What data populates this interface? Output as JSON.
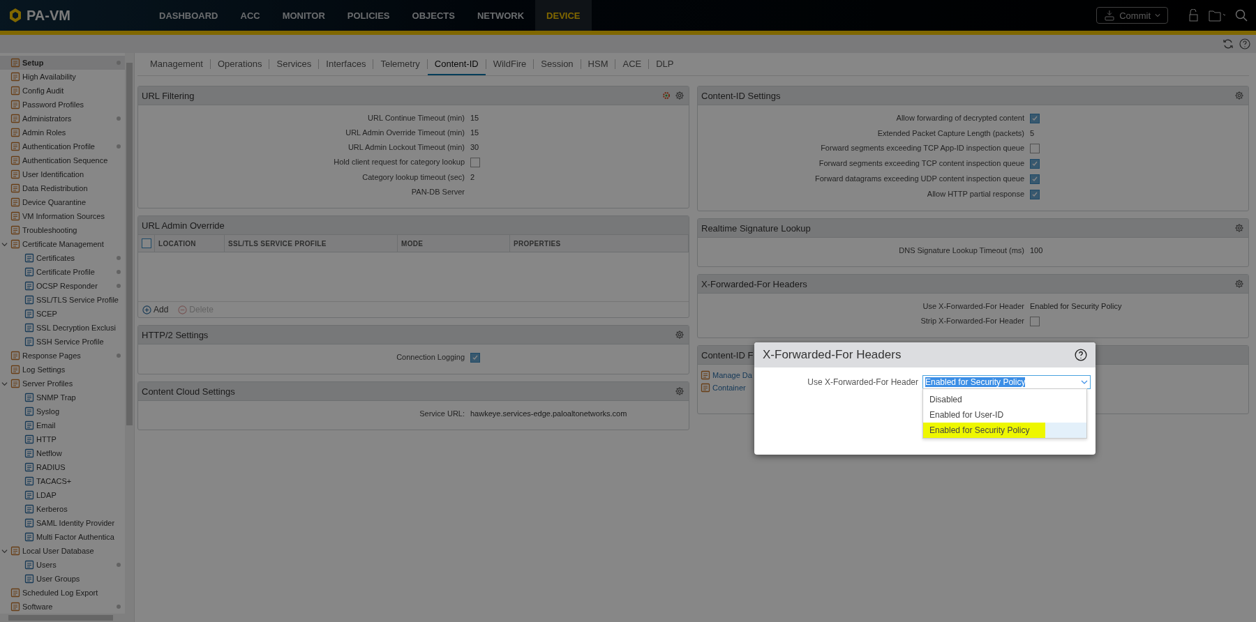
{
  "app": {
    "name": "PA-VM"
  },
  "nav": [
    {
      "label": "DASHBOARD",
      "selected": false
    },
    {
      "label": "ACC",
      "selected": false
    },
    {
      "label": "MONITOR",
      "selected": false
    },
    {
      "label": "POLICIES",
      "selected": false
    },
    {
      "label": "OBJECTS",
      "selected": false
    },
    {
      "label": "NETWORK",
      "selected": false
    },
    {
      "label": "DEVICE",
      "selected": true
    }
  ],
  "commit": {
    "label": "Commit"
  },
  "sidebar": {
    "items": [
      {
        "label": "Setup",
        "selected": true,
        "dot": true
      },
      {
        "label": "High Availability",
        "selected": false,
        "dot": false
      },
      {
        "label": "Config Audit",
        "selected": false,
        "dot": false
      },
      {
        "label": "Password Profiles",
        "selected": false,
        "dot": false
      },
      {
        "label": "Administrators",
        "selected": false,
        "dot": true
      },
      {
        "label": "Admin Roles",
        "selected": false,
        "dot": false
      },
      {
        "label": "Authentication Profile",
        "selected": false,
        "dot": true
      },
      {
        "label": "Authentication Sequence",
        "selected": false,
        "dot": false
      },
      {
        "label": "User Identification",
        "selected": false,
        "dot": false
      },
      {
        "label": "Data Redistribution",
        "selected": false,
        "dot": false
      },
      {
        "label": "Device Quarantine",
        "selected": false,
        "dot": false
      },
      {
        "label": "VM Information Sources",
        "selected": false,
        "dot": false
      },
      {
        "label": "Troubleshooting",
        "selected": false,
        "dot": false
      },
      {
        "label": "Certificate Management",
        "selected": false,
        "dot": false,
        "expanded": true,
        "children": [
          {
            "label": "Certificates",
            "selected": false,
            "dot": true
          },
          {
            "label": "Certificate Profile",
            "selected": false,
            "dot": true
          },
          {
            "label": "OCSP Responder",
            "selected": false,
            "dot": true
          },
          {
            "label": "SSL/TLS Service Profile",
            "selected": false,
            "dot": false
          },
          {
            "label": "SCEP",
            "selected": false,
            "dot": false
          },
          {
            "label": "SSL Decryption Exclusi",
            "selected": false,
            "dot": false
          },
          {
            "label": "SSH Service Profile",
            "selected": false,
            "dot": false
          }
        ]
      },
      {
        "label": "Response Pages",
        "selected": false,
        "dot": true
      },
      {
        "label": "Log Settings",
        "selected": false,
        "dot": false
      },
      {
        "label": "Server Profiles",
        "selected": false,
        "dot": false,
        "expanded": true,
        "children": [
          {
            "label": "SNMP Trap",
            "selected": false,
            "dot": false
          },
          {
            "label": "Syslog",
            "selected": false,
            "dot": false
          },
          {
            "label": "Email",
            "selected": false,
            "dot": false
          },
          {
            "label": "HTTP",
            "selected": false,
            "dot": false
          },
          {
            "label": "Netflow",
            "selected": false,
            "dot": false
          },
          {
            "label": "RADIUS",
            "selected": false,
            "dot": false
          },
          {
            "label": "TACACS+",
            "selected": false,
            "dot": false
          },
          {
            "label": "LDAP",
            "selected": false,
            "dot": false
          },
          {
            "label": "Kerberos",
            "selected": false,
            "dot": false
          },
          {
            "label": "SAML Identity Provider",
            "selected": false,
            "dot": false
          },
          {
            "label": "Multi Factor Authentica",
            "selected": false,
            "dot": false
          }
        ]
      },
      {
        "label": "Local User Database",
        "selected": false,
        "dot": false,
        "expanded": true,
        "children": [
          {
            "label": "Users",
            "selected": false,
            "dot": true
          },
          {
            "label": "User Groups",
            "selected": false,
            "dot": false
          }
        ]
      },
      {
        "label": "Scheduled Log Export",
        "selected": false,
        "dot": false
      },
      {
        "label": "Software",
        "selected": false,
        "dot": true
      }
    ]
  },
  "tabs": [
    {
      "label": "Management",
      "selected": false
    },
    {
      "label": "Operations",
      "selected": false
    },
    {
      "label": "Services",
      "selected": false
    },
    {
      "label": "Interfaces",
      "selected": false
    },
    {
      "label": "Telemetry",
      "selected": false
    },
    {
      "label": "Content-ID",
      "selected": true
    },
    {
      "label": "WildFire",
      "selected": false
    },
    {
      "label": "Session",
      "selected": false
    },
    {
      "label": "HSM",
      "selected": false
    },
    {
      "label": "ACE",
      "selected": false
    },
    {
      "label": "DLP",
      "selected": false
    }
  ],
  "left_panels": [
    {
      "kind": "form",
      "title": "URL Filtering",
      "editable": true,
      "status_icon": true,
      "rows": [
        {
          "kind": "value",
          "label": "URL Continue Timeout (min)",
          "value": "15"
        },
        {
          "kind": "value",
          "label": "URL Admin Override Timeout (min)",
          "value": "15"
        },
        {
          "kind": "value",
          "label": "URL Admin Lockout Timeout (min)",
          "value": "30"
        },
        {
          "kind": "checkbox",
          "label": "Hold client request for category lookup",
          "checked": false
        },
        {
          "kind": "value",
          "label": "Category lookup timeout (sec)",
          "value": "2"
        },
        {
          "kind": "label",
          "label": "PAN-DB Server"
        }
      ]
    },
    {
      "kind": "table",
      "title": "URL Admin Override",
      "editable": false,
      "status_icon": false,
      "header_checked": false,
      "columns": [
        "LOCATION",
        "SSL/TLS SERVICE PROFILE",
        "MODE",
        "PROPERTIES"
      ],
      "actions": [
        {
          "label": "Add",
          "disabled": false
        },
        {
          "label": "Delete",
          "disabled": true
        }
      ]
    },
    {
      "kind": "form",
      "title": "HTTP/2 Settings",
      "editable": true,
      "status_icon": false,
      "rows": [
        {
          "kind": "checkbox",
          "label": "Connection Logging",
          "checked": true
        }
      ]
    },
    {
      "kind": "form",
      "title": "Content Cloud Settings",
      "editable": true,
      "status_icon": false,
      "rows": [
        {
          "kind": "value",
          "label": "Service URL:",
          "value": "hawkeye.services-edge.paloaltonetworks.com"
        }
      ]
    }
  ],
  "right_panels": [
    {
      "kind": "form",
      "title": "Content-ID Settings",
      "editable": true,
      "status_icon": false,
      "rows": [
        {
          "kind": "checkbox",
          "label": "Allow forwarding of decrypted content",
          "checked": true
        },
        {
          "kind": "value",
          "label": "Extended Packet Capture Length (packets)",
          "value": "5"
        },
        {
          "kind": "checkbox",
          "label": "Forward segments exceeding TCP App-ID inspection queue",
          "checked": false
        },
        {
          "kind": "checkbox",
          "label": "Forward segments exceeding TCP content inspection queue",
          "checked": true
        },
        {
          "kind": "checkbox",
          "label": "Forward datagrams exceeding UDP content inspection queue",
          "checked": true
        },
        {
          "kind": "checkbox",
          "label": "Allow HTTP partial response",
          "checked": true
        }
      ]
    },
    {
      "kind": "form",
      "title": "Realtime Signature Lookup",
      "editable": true,
      "status_icon": false,
      "rows": [
        {
          "kind": "value",
          "label": "DNS Signature Lookup Timeout (ms)",
          "value": "100"
        }
      ]
    },
    {
      "kind": "form",
      "title": "X-Forwarded-For Headers",
      "editable": true,
      "status_icon": false,
      "rows": [
        {
          "kind": "value",
          "label": "Use X-Forwarded-For Header",
          "value": "Enabled for Security Policy"
        },
        {
          "kind": "checkbox",
          "label": "Strip X-Forwarded-For Header",
          "checked": false
        }
      ]
    },
    {
      "kind": "links",
      "title": "Content-ID F",
      "editable": false,
      "status_icon": false,
      "links": [
        "Manage Da",
        "Container"
      ]
    }
  ],
  "dialog": {
    "title": "X-Forwarded-For Headers",
    "field_label": "Use X-Forwarded-For Header",
    "value": "Enabled for Security Policy",
    "options": [
      {
        "label": "Disabled",
        "selected": false,
        "highlighted": false
      },
      {
        "label": "Enabled for User-ID",
        "selected": false,
        "highlighted": false
      },
      {
        "label": "Enabled for Security Policy",
        "selected": true,
        "highlighted": true
      }
    ]
  }
}
